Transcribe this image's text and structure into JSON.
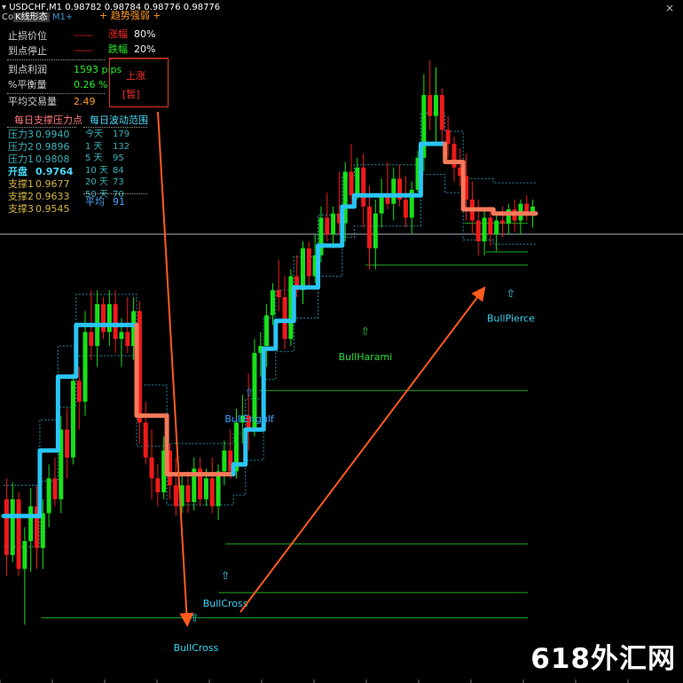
{
  "chart_data": {
    "type": "candlestick",
    "symbol_label": "USDCHF,M1",
    "ohlc_text": "0.98782 0.98784 0.98776 0.98776",
    "current_price": 0.98776,
    "price_range": [
      0.9545,
      0.99
    ],
    "candles": [
      [
        0.963,
        0.9645,
        0.9575,
        0.959
      ],
      [
        0.959,
        0.9642,
        0.9585,
        0.963
      ],
      [
        0.963,
        0.9635,
        0.9575,
        0.958
      ],
      [
        0.958,
        0.961,
        0.954,
        0.96
      ],
      [
        0.96,
        0.9638,
        0.9578,
        0.9625
      ],
      [
        0.9625,
        0.964,
        0.958,
        0.9595
      ],
      [
        0.9595,
        0.963,
        0.958,
        0.962
      ],
      [
        0.962,
        0.9655,
        0.961,
        0.9645
      ],
      [
        0.9645,
        0.966,
        0.9625,
        0.963
      ],
      [
        0.963,
        0.969,
        0.962,
        0.968
      ],
      [
        0.968,
        0.9695,
        0.9645,
        0.966
      ],
      [
        0.966,
        0.972,
        0.9655,
        0.9715
      ],
      [
        0.9715,
        0.9725,
        0.968,
        0.97
      ],
      [
        0.97,
        0.9765,
        0.969,
        0.975
      ],
      [
        0.975,
        0.978,
        0.973,
        0.974
      ],
      [
        0.974,
        0.978,
        0.9725,
        0.977
      ],
      [
        0.977,
        0.9775,
        0.9745,
        0.975
      ],
      [
        0.975,
        0.978,
        0.974,
        0.977
      ],
      [
        0.977,
        0.978,
        0.9735,
        0.9745
      ],
      [
        0.9745,
        0.976,
        0.9725,
        0.975
      ],
      [
        0.975,
        0.9775,
        0.9735,
        0.974
      ],
      [
        0.974,
        0.9775,
        0.973,
        0.9765
      ],
      [
        0.9765,
        0.9772,
        0.967,
        0.9685
      ],
      [
        0.9685,
        0.97,
        0.9655,
        0.966
      ],
      [
        0.966,
        0.968,
        0.963,
        0.9645
      ],
      [
        0.9645,
        0.9655,
        0.9625,
        0.9635
      ],
      [
        0.9635,
        0.9675,
        0.963,
        0.9665
      ],
      [
        0.9665,
        0.967,
        0.963,
        0.964
      ],
      [
        0.964,
        0.966,
        0.9618,
        0.9625
      ],
      [
        0.9625,
        0.9648,
        0.962,
        0.964
      ],
      [
        0.964,
        0.965,
        0.962,
        0.9628
      ],
      [
        0.9628,
        0.966,
        0.9622,
        0.9652
      ],
      [
        0.9652,
        0.966,
        0.9625,
        0.963
      ],
      [
        0.963,
        0.9652,
        0.9625,
        0.9645
      ],
      [
        0.9645,
        0.966,
        0.962,
        0.9625
      ],
      [
        0.9625,
        0.9655,
        0.9615,
        0.965
      ],
      [
        0.965,
        0.9672,
        0.964,
        0.9665
      ],
      [
        0.9665,
        0.968,
        0.9645,
        0.965
      ],
      [
        0.965,
        0.9695,
        0.9645,
        0.9685
      ],
      [
        0.9685,
        0.9705,
        0.967,
        0.969
      ],
      [
        0.969,
        0.972,
        0.9665,
        0.968
      ],
      [
        0.968,
        0.9745,
        0.9675,
        0.9735
      ],
      [
        0.9735,
        0.975,
        0.9718,
        0.974
      ],
      [
        0.974,
        0.977,
        0.9725,
        0.9762
      ],
      [
        0.9762,
        0.9785,
        0.9755,
        0.978
      ],
      [
        0.978,
        0.9802,
        0.9765,
        0.9775
      ],
      [
        0.9775,
        0.979,
        0.9738,
        0.9745
      ],
      [
        0.9745,
        0.9795,
        0.974,
        0.979
      ],
      [
        0.979,
        0.9805,
        0.9775,
        0.978
      ],
      [
        0.978,
        0.9815,
        0.977,
        0.981
      ],
      [
        0.981,
        0.9815,
        0.9782,
        0.979
      ],
      [
        0.979,
        0.982,
        0.9785,
        0.9805
      ],
      [
        0.9805,
        0.984,
        0.98,
        0.9832
      ],
      [
        0.9832,
        0.985,
        0.9815,
        0.982
      ],
      [
        0.982,
        0.984,
        0.981,
        0.9835
      ],
      [
        0.9835,
        0.9865,
        0.982,
        0.9828
      ],
      [
        0.9828,
        0.9872,
        0.9815,
        0.9865
      ],
      [
        0.9865,
        0.9885,
        0.984,
        0.9848
      ],
      [
        0.9848,
        0.9875,
        0.9845,
        0.9868
      ],
      [
        0.9868,
        0.9878,
        0.9825,
        0.984
      ],
      [
        0.984,
        0.9855,
        0.9795,
        0.981
      ],
      [
        0.981,
        0.9845,
        0.9795,
        0.9835
      ],
      [
        0.9835,
        0.986,
        0.9825,
        0.9848
      ],
      [
        0.9848,
        0.9872,
        0.9838,
        0.9842
      ],
      [
        0.9842,
        0.9868,
        0.983,
        0.986
      ],
      [
        0.986,
        0.987,
        0.984,
        0.9845
      ],
      [
        0.9845,
        0.9862,
        0.9825,
        0.9832
      ],
      [
        0.9832,
        0.9858,
        0.982,
        0.9852
      ],
      [
        0.9852,
        0.988,
        0.985,
        0.9875
      ],
      [
        0.9875,
        0.9935,
        0.9865,
        0.992
      ],
      [
        0.992,
        0.9945,
        0.9895,
        0.9905
      ],
      [
        0.9905,
        0.994,
        0.9885,
        0.992
      ],
      [
        0.992,
        0.9925,
        0.9885,
        0.9895
      ],
      [
        0.9895,
        0.9905,
        0.9875,
        0.9885
      ],
      [
        0.9885,
        0.989,
        0.9858,
        0.9868
      ],
      [
        0.9868,
        0.9882,
        0.9855,
        0.9862
      ],
      [
        0.9862,
        0.9878,
        0.983,
        0.9845
      ],
      [
        0.9845,
        0.9858,
        0.982,
        0.983
      ],
      [
        0.983,
        0.9845,
        0.9805,
        0.9815
      ],
      [
        0.9815,
        0.9838,
        0.9805,
        0.9832
      ],
      [
        0.9832,
        0.984,
        0.9812,
        0.982
      ],
      [
        0.982,
        0.9835,
        0.9808,
        0.983
      ],
      [
        0.983,
        0.984,
        0.9818,
        0.9828
      ],
      [
        0.9828,
        0.9842,
        0.982,
        0.9838
      ],
      [
        0.9838,
        0.9845,
        0.9822,
        0.983
      ],
      [
        0.983,
        0.9845,
        0.982,
        0.9842
      ],
      [
        0.9842,
        0.9848,
        0.983,
        0.9835
      ],
      [
        0.9835,
        0.9845,
        0.9825,
        0.984
      ]
    ],
    "trend_line": [
      0.9618,
      0.9618,
      0.9618,
      0.9618,
      0.9618,
      0.9618,
      0.9665,
      0.9665,
      0.9665,
      0.9718,
      0.9718,
      0.9718,
      0.9755,
      0.9755,
      0.9755,
      0.9755,
      0.9755,
      0.9755,
      0.9755,
      0.9755,
      0.9755,
      0.9755,
      0.969,
      0.969,
      0.969,
      0.969,
      0.969,
      0.9648,
      0.9648,
      0.9648,
      0.9648,
      0.9648,
      0.9648,
      0.9648,
      0.9648,
      0.9648,
      0.9648,
      0.9648,
      0.9655,
      0.9655,
      0.968,
      0.968,
      0.968,
      0.9738,
      0.9738,
      0.9758,
      0.9758,
      0.9758,
      0.9782,
      0.9782,
      0.9782,
      0.9782,
      0.9812,
      0.9812,
      0.9812,
      0.9812,
      0.984,
      0.984,
      0.9848,
      0.9848,
      0.9848,
      0.9848,
      0.9848,
      0.9848,
      0.9848,
      0.9848,
      0.9848,
      0.9848,
      0.9848,
      0.9885,
      0.9885,
      0.9885,
      0.9885,
      0.9872,
      0.9872,
      0.9872,
      0.9838,
      0.9838,
      0.9838,
      0.9838,
      0.9838,
      0.9835,
      0.9835,
      0.9835,
      0.9835,
      0.9835,
      0.9835,
      0.9835
    ],
    "trend_colors": [
      "up",
      "up",
      "up",
      "up",
      "up",
      "up",
      "up",
      "up",
      "up",
      "up",
      "up",
      "up",
      "up",
      "up",
      "up",
      "up",
      "up",
      "up",
      "up",
      "up",
      "up",
      "up",
      "down",
      "down",
      "down",
      "down",
      "down",
      "down",
      "down",
      "down",
      "down",
      "down",
      "down",
      "down",
      "down",
      "down",
      "down",
      "down",
      "up",
      "up",
      "up",
      "up",
      "up",
      "up",
      "up",
      "up",
      "up",
      "up",
      "up",
      "up",
      "up",
      "up",
      "up",
      "up",
      "up",
      "up",
      "up",
      "up",
      "up",
      "up",
      "up",
      "up",
      "up",
      "up",
      "up",
      "up",
      "up",
      "up",
      "up",
      "up",
      "up",
      "up",
      "up",
      "down",
      "down",
      "down",
      "down",
      "down",
      "down",
      "down",
      "down",
      "down",
      "down",
      "down",
      "down",
      "down",
      "down",
      "down"
    ],
    "support_lines": [
      {
        "price": 0.9545,
        "from": 0.06,
        "label": ""
      },
      {
        "price": 0.9563,
        "from": 0.32,
        "label": ""
      },
      {
        "price": 0.9598,
        "from": 0.33,
        "label": ""
      },
      {
        "price": 0.9708,
        "from": 0.38,
        "label": ""
      },
      {
        "price": 0.9798,
        "from": 0.535,
        "label": ""
      },
      {
        "price": 0.9828,
        "from": 0.68,
        "label": ""
      }
    ],
    "patterns": [
      {
        "label": "BullCross",
        "x": 0.287,
        "y": 0.953,
        "ax": 0.285,
        "ay": 0.91,
        "color": "#39d3f2"
      },
      {
        "label": "BullCross",
        "x": 0.33,
        "y": 0.888,
        "ax": 0.33,
        "ay": 0.848,
        "color": "#39d3f2"
      },
      {
        "label": "BullEngulf",
        "x": 0.365,
        "y": 0.618,
        "ax": 0.365,
        "ay": 0.58,
        "color": "#2aa6ff"
      },
      {
        "label": "BullHarami",
        "x": 0.535,
        "y": 0.527,
        "ax": 0.535,
        "ay": 0.49,
        "color": "#22dd33"
      },
      {
        "label": "BullPierce",
        "x": 0.748,
        "y": 0.471,
        "ax": 0.748,
        "ay": 0.435,
        "color": "#39d3f2"
      }
    ]
  },
  "header": {
    "symbol": "USDCHF,M1",
    "ohlc": "0.98782 0.98784 0.98776 0.98776",
    "indicator_name": "K线形态",
    "timeframe": "M1+",
    "trend_label": "+ 趋势强弱 +",
    "copyright_prefix": "Co"
  },
  "panel": {
    "stop_loss_label": "止损价位",
    "stop_loss_value": "-------",
    "take_profit_label": "到点停止",
    "take_profit_value": "-------",
    "rise_label": "涨幅",
    "rise_value": "80%",
    "fall_label": "跌幅",
    "fall_value": "20%",
    "profit_label": "到点利润",
    "profit_value": "1593 pips",
    "balance_label": "%平衡量",
    "balance_value": "0.26 %",
    "avg_label": "平均交易量",
    "avg_value": "2.49",
    "signal_top": "上涨",
    "signal_bottom": "[暂]"
  },
  "pivot": {
    "title": "每日支撑压力点",
    "rows": [
      {
        "label": "压力3",
        "value": "0.9940",
        "color": "#3bb2b8"
      },
      {
        "label": "压力2",
        "value": "0.9896",
        "color": "#3bb2b8"
      },
      {
        "label": "压力1",
        "value": "0.9808",
        "color": "#3bb2b8"
      },
      {
        "label": "开盘",
        "value": "0.9764",
        "color": "#49d8f7"
      },
      {
        "label": "支撑1",
        "value": "0.9677",
        "color": "#d6b548"
      },
      {
        "label": "支撑2",
        "value": "0.9633",
        "color": "#d6b548"
      },
      {
        "label": "支撑3",
        "value": "0.9545",
        "color": "#d6b548"
      }
    ]
  },
  "range": {
    "title": "每日波动范围",
    "rows": [
      {
        "label": "今天",
        "value": "179"
      },
      {
        "label": "1 天",
        "value": "132"
      },
      {
        "label": "5 天",
        "value": "95"
      },
      {
        "label": "10 天",
        "value": "84"
      },
      {
        "label": "20 天",
        "value": "73"
      },
      {
        "label": "50 天",
        "value": "70"
      }
    ],
    "avg_label": "平均",
    "avg_value": "91"
  },
  "watermark": "618外汇网",
  "close_glyph": "×",
  "colors": {
    "bull_candle": "#18e018",
    "bear_candle": "#ee1a1a",
    "trend_up": "#29c5f6",
    "trend_down": "#f47a5a",
    "arrow": "#ff5a1f",
    "support": "#22aa22",
    "price_line": "#a7b3c1"
  }
}
